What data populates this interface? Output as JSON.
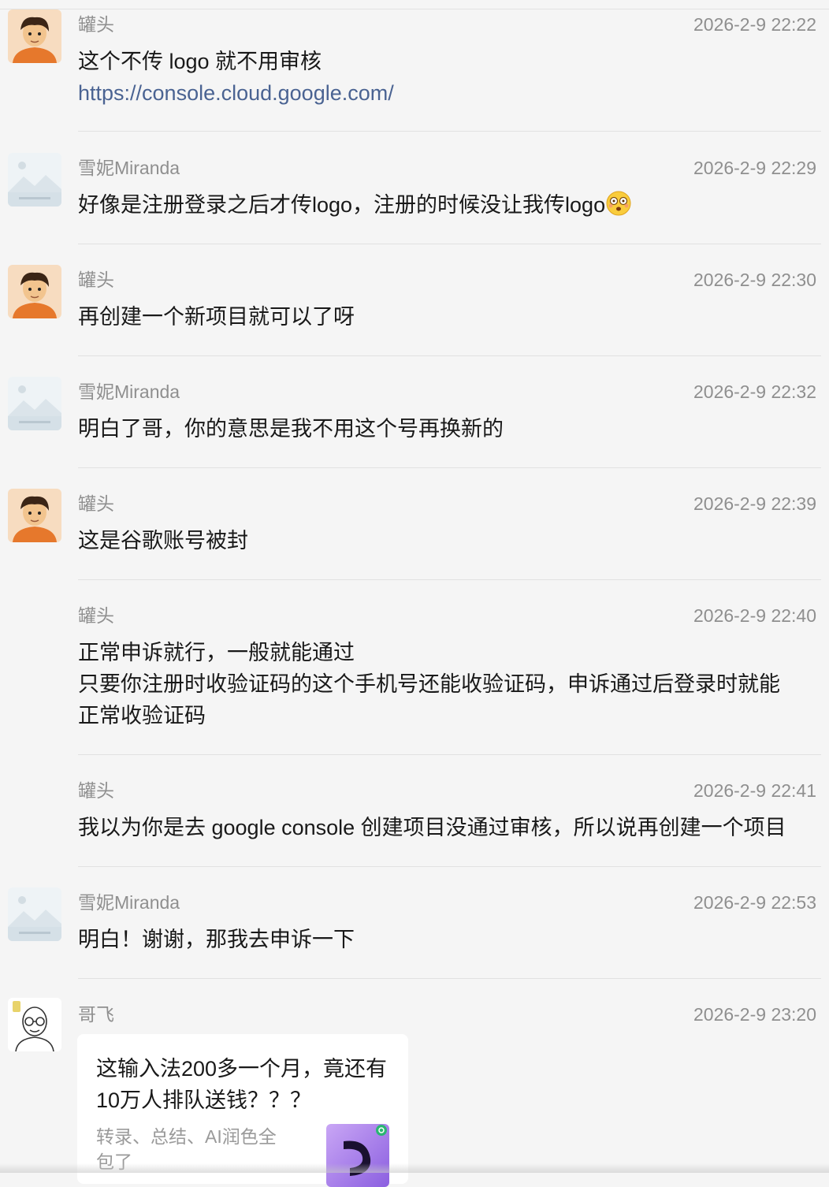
{
  "messages": [
    {
      "sender": "罐头",
      "time": "2026-2-9 22:22",
      "text": "这个不传 logo 就不用审核",
      "link": "https://console.cloud.google.com/"
    },
    {
      "sender": "雪妮Miranda",
      "time": "2026-2-9 22:29",
      "text": "好像是注册登录之后才传logo，注册的时候没让我传logo",
      "emoji": "dizzy-face-emoji"
    },
    {
      "sender": "罐头",
      "time": "2026-2-9 22:30",
      "text": "再创建一个新项目就可以了呀"
    },
    {
      "sender": "雪妮Miranda",
      "time": "2026-2-9 22:32",
      "text": "明白了哥，你的意思是我不用这个号再换新的"
    },
    {
      "sender": "罐头",
      "time": "2026-2-9 22:39",
      "text": "这是谷歌账号被封"
    },
    {
      "sender": "罐头",
      "time": "2026-2-9 22:40",
      "text": "正常申诉就行，一般就能通过\n只要你注册时收验证码的这个手机号还能收验证码，申诉通过后登录时就能\n正常收验证码"
    },
    {
      "sender": "罐头",
      "time": "2026-2-9 22:41",
      "text": "我以为你是去 google console 创建项目没通过审核，所以说再创建一个项目"
    },
    {
      "sender": "雪妮Miranda",
      "time": "2026-2-9 22:53",
      "text": "明白！谢谢，那我去申诉一下"
    },
    {
      "sender": "哥飞",
      "time": "2026-2-9 23:20"
    }
  ],
  "card": {
    "title": "这输入法200多一个月，竟还有10万人排队送钱？？？",
    "description": "转录、总结、AI润色全包了",
    "thumb_icon": "app-logo-icon"
  },
  "avatars": {
    "guantou": "cartoon-boy-avatar",
    "miranda": "landscape-placeholder-avatar",
    "gefei": "bald-man-glasses-avatar"
  },
  "colors": {
    "background": "#f5f5f5",
    "link": "#4a6392",
    "meta": "#8f8f8f",
    "text": "#191919"
  }
}
